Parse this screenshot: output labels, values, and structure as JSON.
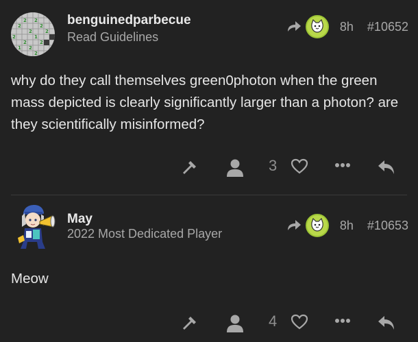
{
  "colors": {
    "background": "#222222",
    "text": "#e6e6e6",
    "muted": "#a8a8a8",
    "icon": "#a8a8a8",
    "reply_avatar": "#b9d84a"
  },
  "posts": [
    {
      "username": "benguinedparbecue",
      "user_title": "Read Guidelines",
      "avatar_icon": "minesweeper-grid-avatar",
      "reply_to_icon": "green-cat-avatar",
      "time": "8h",
      "post_number": "#10652",
      "body": "why do they call themselves green0photon when the green mass depicted is clearly significantly larger than a photon? are they scientifically misinformed?",
      "like_count": "3"
    },
    {
      "username": "May",
      "user_title": "2022 Most Dedicated Player",
      "avatar_icon": "anime-girl-megaphone-avatar",
      "reply_to_icon": "green-cat-avatar",
      "time": "8h",
      "post_number": "#10653",
      "body": "Meow",
      "like_count": "4"
    }
  ]
}
